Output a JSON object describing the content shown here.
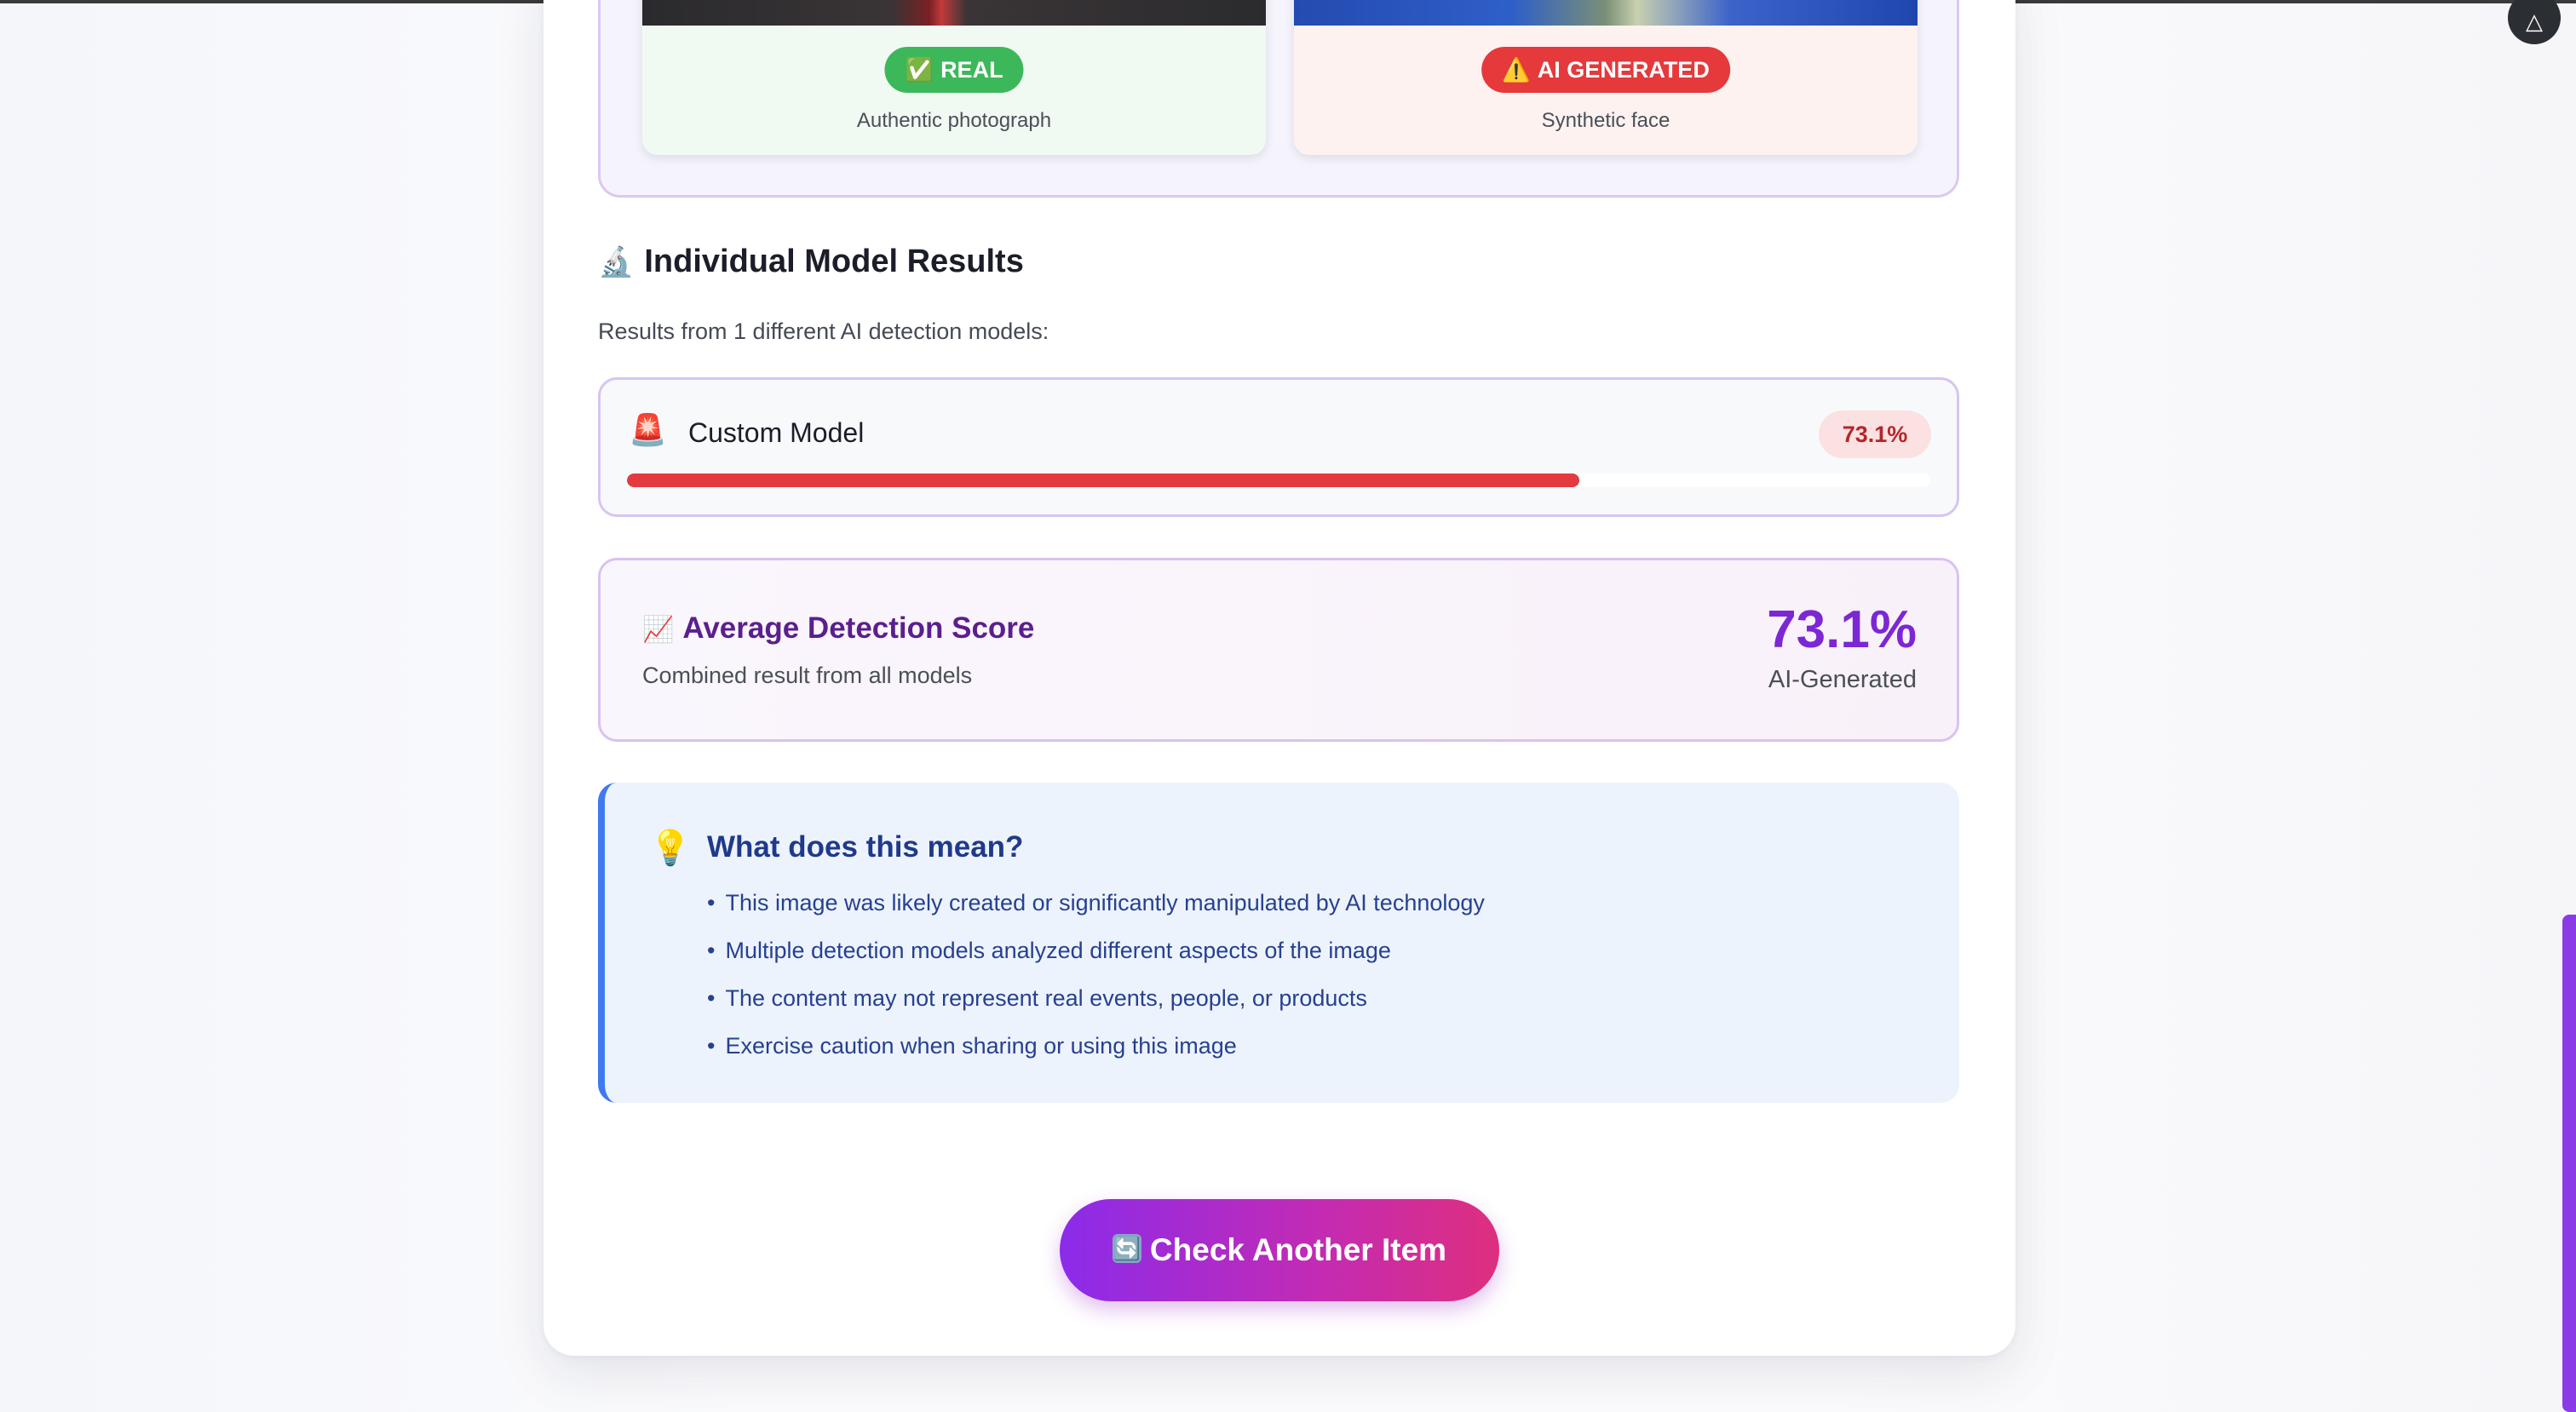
{
  "comparison": {
    "real": {
      "badge": "REAL",
      "badge_icon": "✅",
      "caption": "Authentic photograph",
      "color": "#3cb85a"
    },
    "ai": {
      "badge": "AI GENERATED",
      "badge_icon": "⚠️",
      "caption": "Synthetic face",
      "color": "#e5393c"
    }
  },
  "models_section": {
    "icon": "🔬",
    "title": "Individual Model Results",
    "subtitle": "Results from 1 different AI detection models:",
    "models": [
      {
        "icon": "🚨",
        "name": "Custom Model",
        "score_label": "73.1%",
        "score": 0.731,
        "color": "#e23a3e"
      }
    ]
  },
  "average": {
    "icon": "📈",
    "title": "Average Detection Score",
    "subtitle": "Combined result from all models",
    "value": "73.1%",
    "label": "AI-Generated",
    "accent": "#7c27d4"
  },
  "info": {
    "icon": "💡",
    "title": "What does this mean?",
    "points": [
      "This image was likely created or significantly manipulated by AI technology",
      "Multiple detection models analyzed different aspects of the image",
      "The content may not represent real events, people, or products",
      "Exercise caution when sharing or using this image"
    ]
  },
  "cta": {
    "icon": "🔄",
    "label": "Check Another Item"
  },
  "corner_button": {
    "icon": "△"
  }
}
